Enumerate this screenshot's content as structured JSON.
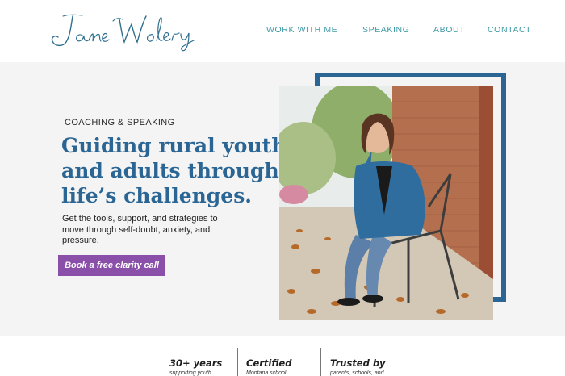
{
  "header": {
    "logo_text": "Jane Wolery",
    "nav": [
      {
        "label": "WORK WITH ME"
      },
      {
        "label": "SPEAKING"
      },
      {
        "label": "ABOUT"
      },
      {
        "label": "CONTACT"
      }
    ]
  },
  "hero": {
    "eyebrow": "COACHING & SPEAKING",
    "headline": [
      "Guiding rural youth",
      "and adults through",
      "life’s challenges."
    ],
    "subtext": "Get the tools, support, and strategies to move through self-doubt, anxiety, and pressure.",
    "cta_label": "Book a free clarity call"
  },
  "stats": [
    {
      "title": "30+ years",
      "subtitle": "supporting youth"
    },
    {
      "title": "Certified",
      "subtitle": "Montana school"
    },
    {
      "title": "Trusted by",
      "subtitle": "parents, schools, and"
    }
  ],
  "colors": {
    "nav": "#3e9aa6",
    "headline": "#2a6593",
    "frame": "#2a6593",
    "cta": "#8a4fa8",
    "hero_bg": "#f4f4f4"
  }
}
